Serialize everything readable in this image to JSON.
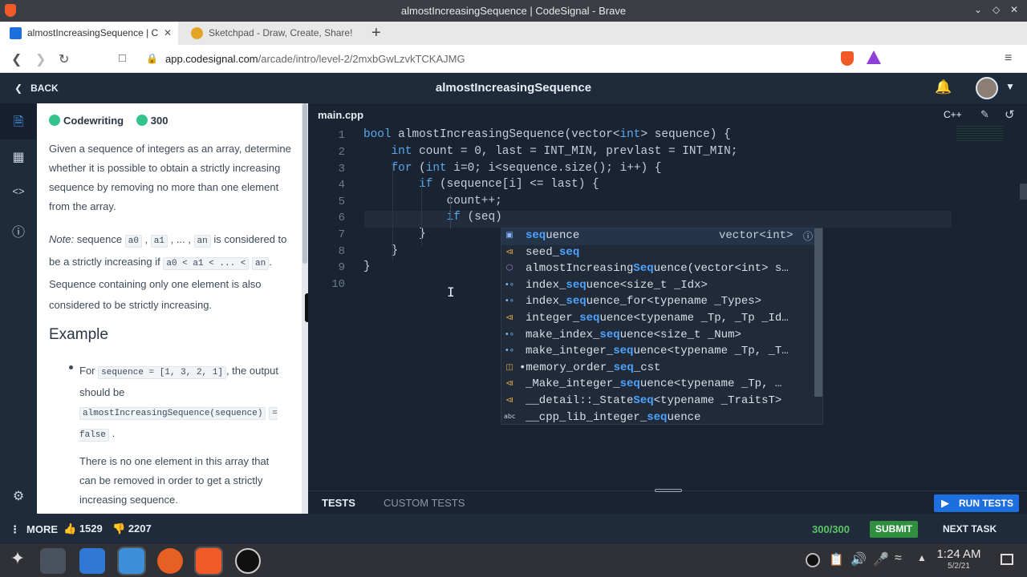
{
  "window": {
    "title": "almostIncreasingSequence | CodeSignal - Brave"
  },
  "browser": {
    "tabs": [
      {
        "label": "almostIncreasingSequence | C"
      },
      {
        "label": "Sketchpad - Draw, Create, Share!"
      }
    ],
    "url_host": "app.codesignal.com",
    "url_path": "/arcade/intro/level-2/2mxbGwLzvkTCKAJMG"
  },
  "app": {
    "back_label": "BACK",
    "title": "almostIncreasingSequence"
  },
  "description": {
    "badge_label": "Codewriting",
    "points": "300",
    "intro": "Given a sequence of integers as an array, determine whether it is possible to obtain a strictly increasing sequence by removing no more than one element from the array.",
    "note_prefix": "Note:",
    "note_text_1": "sequence",
    "note_a0": "a0",
    "note_a1": "a1",
    "note_dots": "...",
    "note_an": "an",
    "note_text_2": "is considered to be a strictly increasing if",
    "note_ineq": "a0 < a1 < ... <",
    "note_an2": "an",
    "note_text_3": ". Sequence containing only one element is also considered to be strictly increasing.",
    "example_heading": "Example",
    "example_for": "For",
    "example_seq": "sequence = [1, 3, 2, 1]",
    "example_output_text": ", the output should be",
    "example_call": "almostIncreasingSequence(sequence)",
    "example_result": "= false",
    "example_explanation": "There is no one element in this array that can be removed in order to get a strictly increasing sequence."
  },
  "editor": {
    "file_tab": "main.cpp",
    "language": "C++",
    "line_numbers": [
      "1",
      "2",
      "3",
      "4",
      "5",
      "6",
      "7",
      "8",
      "9",
      "10"
    ],
    "lines": [
      "bool almostIncreasingSequence(vector<int> sequence) {",
      "    int count = 0, last = INT_MIN, prevlast = INT_MIN;",
      "    for (int i=0; i<sequence.size(); i++) {",
      "        if (sequence[i] <= last) {",
      "            count++;",
      "            if (seq)",
      "        }",
      "    }",
      "}",
      ""
    ]
  },
  "autocomplete": {
    "items": [
      {
        "icon": "field-icon",
        "pre": "",
        "match": "seq",
        "post": "uence",
        "detail": "vector<int>"
      },
      {
        "icon": "keyword-icon",
        "pre": "seed_",
        "match": "seq",
        "post": "",
        "detail": ""
      },
      {
        "icon": "method-icon",
        "pre": "almostIncreasing",
        "match": "Seq",
        "post": "uence(vector<int> s…",
        "detail": ""
      },
      {
        "icon": "class-icon",
        "pre": "index_",
        "match": "seq",
        "post": "uence<size_t _Idx>",
        "detail": ""
      },
      {
        "icon": "class-icon",
        "pre": "index_",
        "match": "seq",
        "post": "uence_for<typename _Types>",
        "detail": ""
      },
      {
        "icon": "keyword-icon",
        "pre": "integer_",
        "match": "seq",
        "post": "uence<typename _Tp, _Tp _Id…",
        "detail": ""
      },
      {
        "icon": "class-icon",
        "pre": "make_index_",
        "match": "seq",
        "post": "uence<size_t _Num>",
        "detail": ""
      },
      {
        "icon": "class-icon",
        "pre": "make_integer_",
        "match": "seq",
        "post": "uence<typename _Tp, _T…",
        "detail": ""
      },
      {
        "icon": "enum-icon",
        "pre": "•memory_order_",
        "match": "seq",
        "post": "_cst",
        "detail": ""
      },
      {
        "icon": "keyword-icon",
        "pre": "_Make_integer_",
        "match": "seq",
        "post": "uence<typename _Tp, …",
        "detail": ""
      },
      {
        "icon": "keyword-icon",
        "pre": "__detail::_State",
        "match": "Seq",
        "post": "<typename _TraitsT>",
        "detail": ""
      },
      {
        "icon": "text-icon",
        "pre": "__cpp_lib_integer_",
        "match": "seq",
        "post": "uence",
        "detail": ""
      }
    ]
  },
  "tests": {
    "tab_tests": "TESTS",
    "tab_custom": "CUSTOM TESTS",
    "run_label": "RUN TESTS"
  },
  "footer": {
    "more_label": "MORE",
    "likes": "1529",
    "dislikes": "2207",
    "score": "300/300",
    "submit_label": "SUBMIT",
    "next_label": "NEXT TASK"
  },
  "taskbar": {
    "time": "1:24 AM",
    "date": "5/2/21"
  },
  "colors": {
    "app_bg": "#1f2a3a",
    "editor_bg": "#1a2332",
    "accent_blue": "#1d6fe0",
    "submit_green": "#2f8f3e",
    "keyword": "#5aa8e8",
    "match_highlight": "#4da3ff"
  }
}
